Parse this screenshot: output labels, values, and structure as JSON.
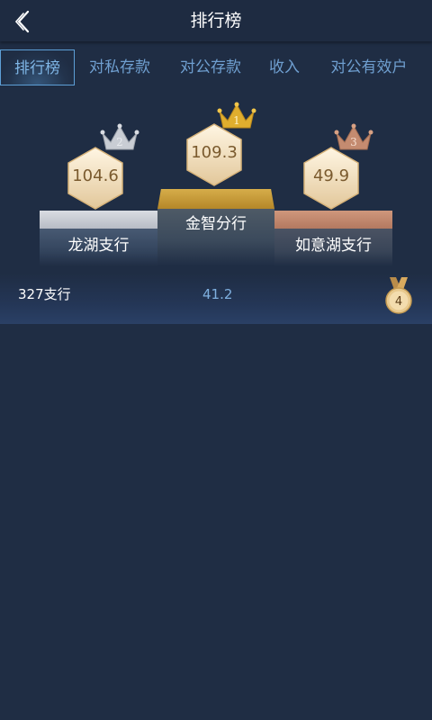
{
  "header": {
    "title": "排行榜",
    "back_icon": "chevron-left-icon"
  },
  "tabs": [
    {
      "label": "排行榜",
      "active": true
    },
    {
      "label": "对私存款",
      "active": false
    },
    {
      "label": "对公存款",
      "active": false
    },
    {
      "label": "收入",
      "active": false
    },
    {
      "label": "对公有效户",
      "active": false
    }
  ],
  "podium": {
    "first": {
      "rank": "1",
      "value": "109.3",
      "name": "金智分行",
      "color": "#c69a36"
    },
    "second": {
      "rank": "2",
      "value": "104.6",
      "name": "龙湖支行",
      "color": "#c9cdd4"
    },
    "third": {
      "rank": "3",
      "value": "49.9",
      "name": "如意湖支行",
      "color": "#c48b70"
    }
  },
  "list": [
    {
      "name": "327支行",
      "value": "41.2",
      "rank": "4",
      "icon": "medal-icon"
    }
  ],
  "colors": {
    "background": "#1f2d44",
    "accent": "#5d9fd6",
    "gold": "#c69a36",
    "silver": "#c9cdd4",
    "bronze": "#c48b70"
  }
}
